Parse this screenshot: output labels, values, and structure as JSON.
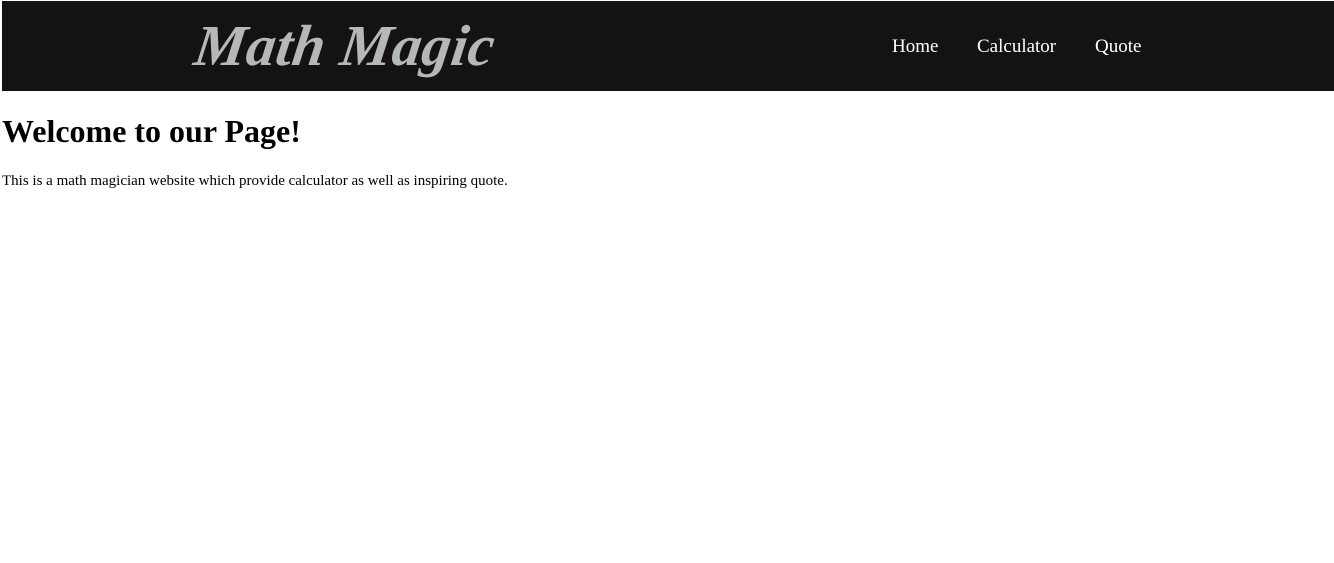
{
  "header": {
    "logo_text": "Math Magic",
    "nav": [
      {
        "label": "Home"
      },
      {
        "label": "Calculator"
      },
      {
        "label": "Quote"
      }
    ]
  },
  "main": {
    "heading": "Welcome to our Page!",
    "description": "This is a math magician website which provide calculator as well as inspiring quote."
  },
  "colors": {
    "navbar_background": "#141213",
    "logo_color": "#b5b9b6",
    "nav_link_color": "#ffffff",
    "page_background": "#ffffff",
    "text_color": "#000000"
  }
}
